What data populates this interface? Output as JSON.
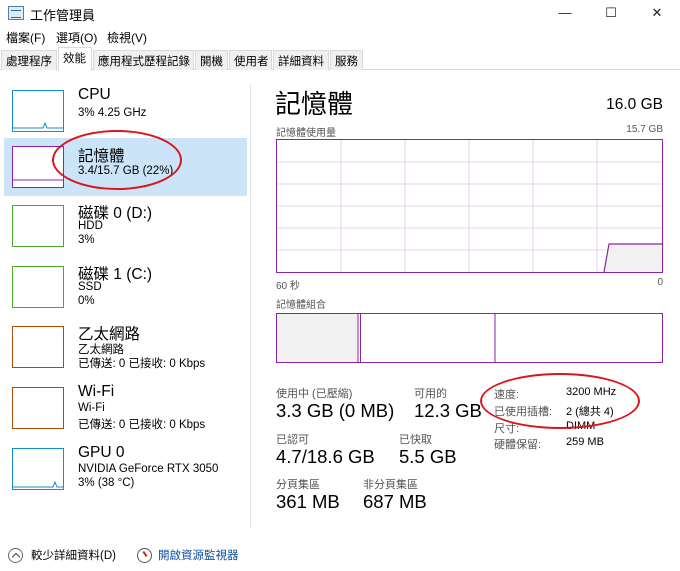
{
  "window": {
    "title": "工作管理員",
    "min": "—",
    "max": "☐",
    "close": "✕"
  },
  "menu": [
    "檔案(F)",
    "選項(O)",
    "檢視(V)"
  ],
  "tabs": [
    "處理程序",
    "效能",
    "應用程式歷程記錄",
    "開機",
    "使用者",
    "詳細資料",
    "服務"
  ],
  "active_tab": "效能",
  "sidebar": [
    {
      "title": "CPU",
      "line1": "3% 4.25 GHz",
      "line2": "",
      "line3": "",
      "color": "#1190c9"
    },
    {
      "title": "記憶體",
      "line1": "3.4/15.7 GB (22%)",
      "line2": "",
      "line3": "",
      "color": "#8b24a8"
    },
    {
      "title": "磁碟 0 (D:)",
      "line1": "HDD",
      "line2": "3%",
      "line3": "",
      "color": "#4da72c"
    },
    {
      "title": "磁碟 1 (C:)",
      "line1": "SSD",
      "line2": "0%",
      "line3": "",
      "color": "#4da72c"
    },
    {
      "title": "乙太網路",
      "line1": "乙太網路",
      "line2": "已傳送: 0 已接收: 0 Kbps",
      "line3": "",
      "color": "#a74f01"
    },
    {
      "title": "Wi-Fi",
      "line1": "Wi-Fi",
      "line2": "已傳送: 0 已接收: 0 Kbps",
      "line3": "",
      "color": "#a74f01"
    },
    {
      "title": "GPU 0",
      "line1": "NVIDIA GeForce RTX 3050",
      "line2": "3% (38 °C)",
      "line3": "",
      "color": "#1190c9"
    }
  ],
  "main": {
    "title": "記憶體",
    "total": "16.0 GB",
    "usage_label": "記憶體使用量",
    "usage_max": "15.7 GB",
    "axis_left": "60 秒",
    "axis_right": "0",
    "composition_label": "記憶體組合",
    "accent": "#8b24a8",
    "stats": {
      "in_use_label": "使用中 (已壓縮)",
      "in_use_value": "3.3 GB (0 MB)",
      "available_label": "可用的",
      "available_value": "12.3 GB",
      "committed_label": "已認可",
      "committed_value": "4.7/18.6 GB",
      "cached_label": "已快取",
      "cached_value": "5.5 GB",
      "paged_label": "分頁集區",
      "paged_value": "361 MB",
      "nonpaged_label": "非分頁集區",
      "nonpaged_value": "687 MB"
    },
    "details": [
      {
        "label": "速度:",
        "value": "3200 MHz"
      },
      {
        "label": "已使用插槽:",
        "value": "2 (總共 4)"
      },
      {
        "label": "尺寸:",
        "value": "DIMM"
      },
      {
        "label": "硬體保留:",
        "value": "259 MB"
      }
    ]
  },
  "footer": {
    "fewer_details": "較少詳細資料(D)",
    "open_monitor": "開啟資源監視器"
  }
}
